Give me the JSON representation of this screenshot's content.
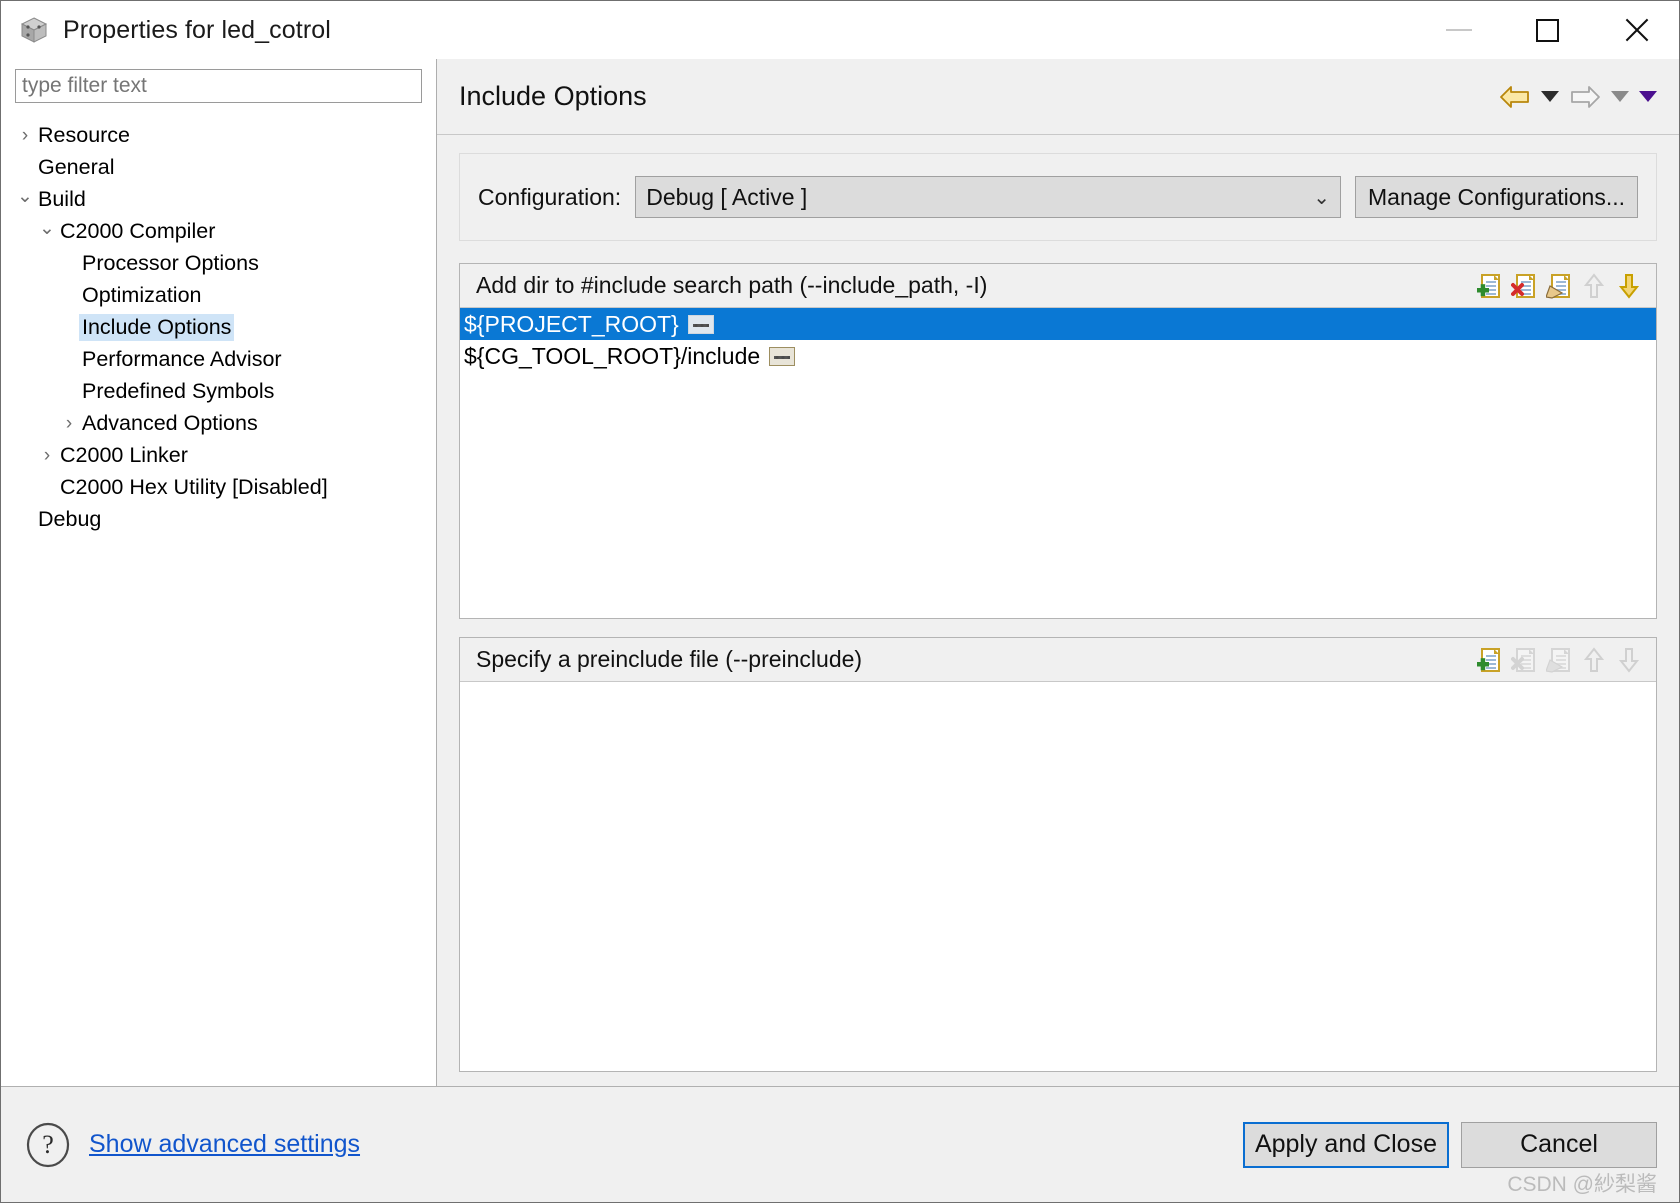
{
  "window": {
    "title": "Properties for led_cotrol",
    "icon": "cube-icon",
    "controls": {
      "minimize": "minimize-icon",
      "maximize": "maximize-icon",
      "close": "close-icon"
    }
  },
  "sidebar": {
    "filter": {
      "value": "",
      "placeholder": "type filter text"
    },
    "items": [
      {
        "label": "Resource",
        "indent": 0,
        "arrow": "closed",
        "selected": false
      },
      {
        "label": "General",
        "indent": 0,
        "arrow": "none",
        "selected": false
      },
      {
        "label": "Build",
        "indent": 0,
        "arrow": "open",
        "selected": false
      },
      {
        "label": "C2000 Compiler",
        "indent": 1,
        "arrow": "open",
        "selected": false
      },
      {
        "label": "Processor Options",
        "indent": 2,
        "arrow": "none",
        "selected": false
      },
      {
        "label": "Optimization",
        "indent": 2,
        "arrow": "none",
        "selected": false
      },
      {
        "label": "Include Options",
        "indent": 2,
        "arrow": "none",
        "selected": true
      },
      {
        "label": "Performance Advisor",
        "indent": 2,
        "arrow": "none",
        "selected": false
      },
      {
        "label": "Predefined Symbols",
        "indent": 2,
        "arrow": "none",
        "selected": false
      },
      {
        "label": "Advanced Options",
        "indent": 2,
        "arrow": "closed",
        "selected": false
      },
      {
        "label": "C2000 Linker",
        "indent": 1,
        "arrow": "closed",
        "selected": false
      },
      {
        "label": "C2000 Hex Utility  [Disabled]",
        "indent": 1,
        "arrow": "none",
        "selected": false
      },
      {
        "label": "Debug",
        "indent": 0,
        "arrow": "none",
        "selected": false
      }
    ]
  },
  "page": {
    "title": "Include Options",
    "nav": {
      "back_icon": "back-arrow-icon",
      "back_menu_icon": "chevron-down-icon",
      "forward_icon": "forward-arrow-icon",
      "forward_menu_icon": "chevron-down-icon",
      "view_menu_icon": "chevron-down-icon"
    }
  },
  "configuration": {
    "label": "Configuration:",
    "selected": "Debug  [ Active ]",
    "options": [
      "Debug  [ Active ]"
    ],
    "caret_icon": "chevron-down-icon",
    "manage_button": "Manage Configurations..."
  },
  "include_paths": {
    "title": "Add dir to #include search path (--include_path, -I)",
    "tools": [
      {
        "name": "add-icon",
        "enabled": true
      },
      {
        "name": "delete-icon",
        "enabled": true
      },
      {
        "name": "edit-icon",
        "enabled": true
      },
      {
        "name": "move-up-icon",
        "enabled": false
      },
      {
        "name": "move-down-icon",
        "enabled": true
      }
    ],
    "rows": [
      {
        "text": "${PROJECT_ROOT}",
        "selected": true,
        "has_browse": true
      },
      {
        "text": "${CG_TOOL_ROOT}/include",
        "selected": false,
        "has_browse": true
      }
    ]
  },
  "preinclude": {
    "title": "Specify a preinclude file (--preinclude)",
    "tools": [
      {
        "name": "add-icon",
        "enabled": true
      },
      {
        "name": "delete-icon",
        "enabled": false
      },
      {
        "name": "edit-icon",
        "enabled": false
      },
      {
        "name": "move-up-icon",
        "enabled": false
      },
      {
        "name": "move-down-icon",
        "enabled": false
      }
    ],
    "rows": []
  },
  "footer": {
    "help_icon": "help-question-icon",
    "advanced_link": "Show advanced settings",
    "apply_button": "Apply and Close",
    "cancel_button": "Cancel",
    "watermark": "CSDN @紗梨酱"
  },
  "colors": {
    "selection_blue": "#0a78d4",
    "tree_selection": "#cfe4f7",
    "link_blue": "#1155cc",
    "focus_border": "#0a6ed1",
    "panel_gray": "#f0f0f0",
    "button_gray": "#dcdcdc",
    "back_arrow_gold": "#d4a017",
    "view_menu_purple": "#4b0f8f"
  }
}
